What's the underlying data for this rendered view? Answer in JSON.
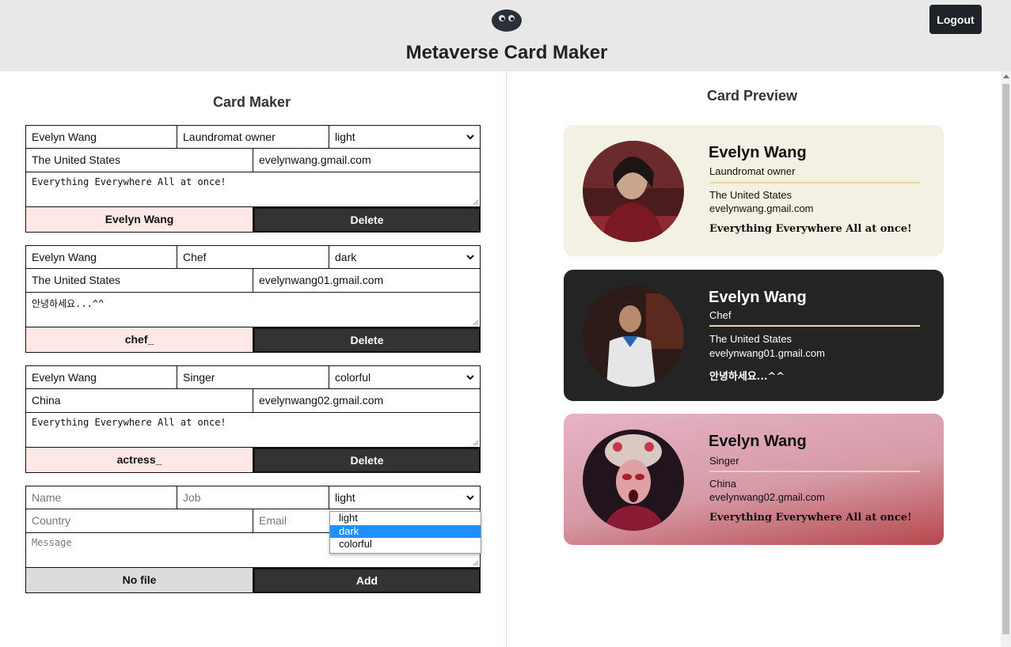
{
  "header": {
    "title": "Metaverse Card Maker",
    "logout_label": "Logout"
  },
  "maker": {
    "title": "Card Maker",
    "cards": [
      {
        "name": "Evelyn Wang",
        "job": "Laundromat owner",
        "theme": "light",
        "country": "The United States",
        "email": "evelynwang.gmail.com",
        "message": "Everything Everywhere All at once!",
        "file_label": "Evelyn Wang",
        "delete_label": "Delete"
      },
      {
        "name": "Evelyn Wang",
        "job": "Chef",
        "theme": "dark",
        "country": "The United States",
        "email": "evelynwang01.gmail.com",
        "message": "안녕하세요...^^",
        "file_label": "chef_",
        "delete_label": "Delete"
      },
      {
        "name": "Evelyn Wang",
        "job": "Singer",
        "theme": "colorful",
        "country": "China",
        "email": "evelynwang02.gmail.com",
        "message": "Everything Everywhere All at once!",
        "file_label": "actress_",
        "delete_label": "Delete"
      }
    ],
    "add_form": {
      "name_placeholder": "Name",
      "job_placeholder": "Job",
      "theme": "light",
      "country_placeholder": "Country",
      "email_placeholder": "Email",
      "message_placeholder": "Message",
      "file_label": "No file",
      "add_label": "Add",
      "theme_options": [
        "light",
        "dark",
        "colorful"
      ],
      "highlighted_option": "dark"
    }
  },
  "preview": {
    "title": "Card Preview",
    "cards": [
      {
        "name": "Evelyn Wang",
        "job": "Laundromat owner",
        "country": "The United States",
        "email": "evelynwang.gmail.com",
        "message": "Everything Everywhere All at once!",
        "theme": "light"
      },
      {
        "name": "Evelyn Wang",
        "job": "Chef",
        "country": "The United States",
        "email": "evelynwang01.gmail.com",
        "message": "안녕하세요...^^",
        "theme": "dark"
      },
      {
        "name": "Evelyn Wang",
        "job": "Singer",
        "country": "China",
        "email": "evelynwang02.gmail.com",
        "message": "Everything Everywhere All at once!",
        "theme": "colorful"
      }
    ]
  },
  "colors": {
    "header_bg": "#e8e8e8",
    "button_dark": "#333333",
    "file_pink": "#fde8e6",
    "card_light": "#f3f1e4",
    "card_dark": "#242424",
    "accent_rule": "#f1d3a8",
    "select_highlight": "#1e90ff"
  },
  "icons": {
    "logo": "blob-logo-icon",
    "select": "chevron-down-icon"
  }
}
